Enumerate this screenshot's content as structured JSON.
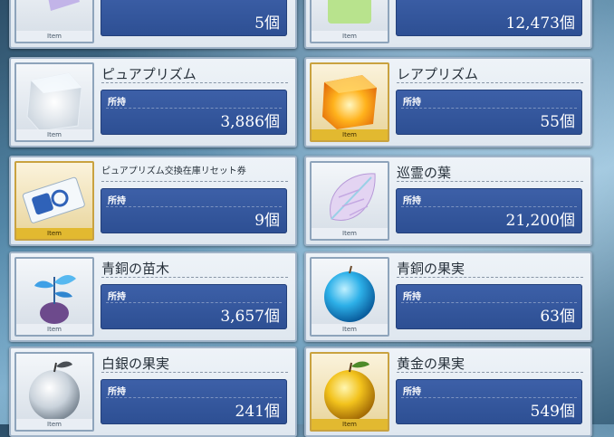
{
  "items": [
    {
      "id": "row0-left",
      "name": "",
      "owned_label": "",
      "count": "5個",
      "thumb_label": "Item",
      "icon": "purple-crystal-icon",
      "rarity": "silver"
    },
    {
      "id": "row0-right",
      "name": "",
      "owned_label": "",
      "count": "12,473個",
      "thumb_label": "Item",
      "icon": "green-prism-icon",
      "rarity": "silver"
    },
    {
      "id": "pure-prism",
      "name": "ピュアプリズム",
      "owned_label": "所持",
      "count": "3,886個",
      "thumb_label": "Item",
      "icon": "white-cube-prism-icon",
      "rarity": "silver"
    },
    {
      "id": "rare-prism",
      "name": "レアプリズム",
      "owned_label": "所持",
      "count": "55個",
      "thumb_label": "Item",
      "icon": "gold-cube-prism-icon",
      "rarity": "gold"
    },
    {
      "id": "pure-prism-ticket",
      "name": "ピュアプリズム交換在庫リセット券",
      "owned_label": "所持",
      "count": "9個",
      "thumb_label": "Item",
      "icon": "ticket-icon",
      "rarity": "gold"
    },
    {
      "id": "junrei-leaf",
      "name": "巡霊の葉",
      "owned_label": "所持",
      "count": "21,200個",
      "thumb_label": "Item",
      "icon": "crystal-leaf-icon",
      "rarity": "silver"
    },
    {
      "id": "bronze-sapling",
      "name": "青銅の苗木",
      "owned_label": "所持",
      "count": "3,657個",
      "thumb_label": "Item",
      "icon": "sapling-icon",
      "rarity": "silver"
    },
    {
      "id": "bronze-fruit",
      "name": "青銅の果実",
      "owned_label": "所持",
      "count": "63個",
      "thumb_label": "Item",
      "icon": "blue-apple-icon",
      "rarity": "silver"
    },
    {
      "id": "silver-fruit",
      "name": "白銀の果実",
      "owned_label": "所持",
      "count": "241個",
      "thumb_label": "Item",
      "icon": "silver-apple-icon",
      "rarity": "silver"
    },
    {
      "id": "gold-fruit",
      "name": "黄金の果実",
      "owned_label": "所持",
      "count": "549個",
      "thumb_label": "Item",
      "icon": "gold-apple-icon",
      "rarity": "gold"
    }
  ],
  "colors": {
    "panel": "#3d60a8",
    "card": "#eef3f8",
    "gold_frame": "#c9a240"
  }
}
